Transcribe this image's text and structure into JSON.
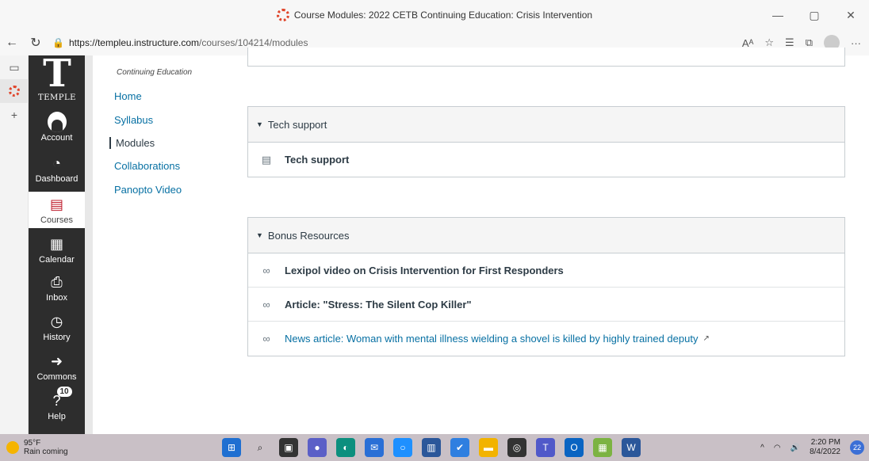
{
  "browser": {
    "window_title": "Course Modules: 2022 CETB Continuing Education: Crisis Intervention",
    "url_host": "https://templeu.instructure.com",
    "url_path": "/courses/104214/modules",
    "win_minimize": "—",
    "win_restore": "▢",
    "win_close": "✕"
  },
  "global_nav": {
    "logo_text": "TEMPLE",
    "items": [
      {
        "label": "Account"
      },
      {
        "label": "Dashboard"
      },
      {
        "label": "Courses"
      },
      {
        "label": "Calendar"
      },
      {
        "label": "Inbox"
      },
      {
        "label": "History"
      },
      {
        "label": "Commons"
      },
      {
        "label": "Help",
        "badge": "10"
      }
    ]
  },
  "course_nav": {
    "subtitle": "Continuing Education",
    "items": [
      {
        "label": "Home"
      },
      {
        "label": "Syllabus"
      },
      {
        "label": "Modules"
      },
      {
        "label": "Collaborations"
      },
      {
        "label": "Panopto Video"
      }
    ]
  },
  "modules": [
    {
      "title": "Tech support",
      "items": [
        {
          "label": "Tech support",
          "type": "page",
          "link": false
        }
      ]
    },
    {
      "title": "Bonus Resources",
      "items": [
        {
          "label": "Lexipol video on Crisis Intervention for First Responders",
          "type": "link",
          "link": false
        },
        {
          "label": "Article: \"Stress: The Silent Cop Killer\"",
          "type": "link",
          "link": false
        },
        {
          "label": "News article: Woman with mental illness wielding a shovel is killed by highly trained deputy",
          "type": "link",
          "link": true
        }
      ]
    }
  ],
  "taskbar": {
    "temperature": "95°F",
    "weather": "Rain coming",
    "time": "2:20 PM",
    "date": "8/4/2022",
    "notification_count": "22"
  },
  "colors": {
    "nav_bg": "#2d2d2d",
    "link": "#0770a3",
    "brand_red": "#bf1e2e"
  }
}
